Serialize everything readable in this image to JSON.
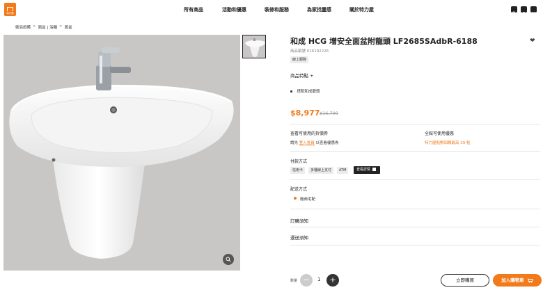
{
  "header": {
    "logo_text": "特力屋",
    "nav": [
      "所有商品",
      "活動和優惠",
      "裝修和服務",
      "為家找靈感",
      "關於特力屋"
    ]
  },
  "breadcrumb": [
    "衛浴設備",
    "面盆 | 浴櫃",
    "面盆"
  ],
  "product": {
    "title": "和成 HCG 增安全面盆附龍頭 LF2685SAdbR-6188",
    "sku": "商品編號 016192226",
    "tag": "線上服務",
    "features_heading": "商品特點 +",
    "features": [
      "搭配和成龍頭"
    ],
    "price": "$8,977",
    "original_price": "$16,700"
  },
  "coupons": {
    "heading": "查看可使用的折價券",
    "prefix": "請先",
    "login_link": "登入會員",
    "suffix": "以查看優惠券"
  },
  "store_offer": {
    "heading": "全館可使用優惠",
    "detail": "特力屋點數回饋最高 29 點"
  },
  "payment": {
    "heading": "付款方式",
    "methods": [
      "信用卡",
      "多種線上支付",
      "ATM"
    ],
    "details_button": "查看詳情"
  },
  "shipping": {
    "heading": "配送方式",
    "option": "廠商宅配"
  },
  "accordions": [
    "訂購須知",
    "運送須知"
  ],
  "purchase": {
    "qty_label": "數量",
    "qty_value": "1",
    "minus": "−",
    "plus": "+",
    "buy_now": "立即購買",
    "add_to_cart": "加入購物車"
  },
  "colors": {
    "accent": "#f27a1a",
    "dark": "#222222",
    "image_bg": "#c8c7c5"
  }
}
